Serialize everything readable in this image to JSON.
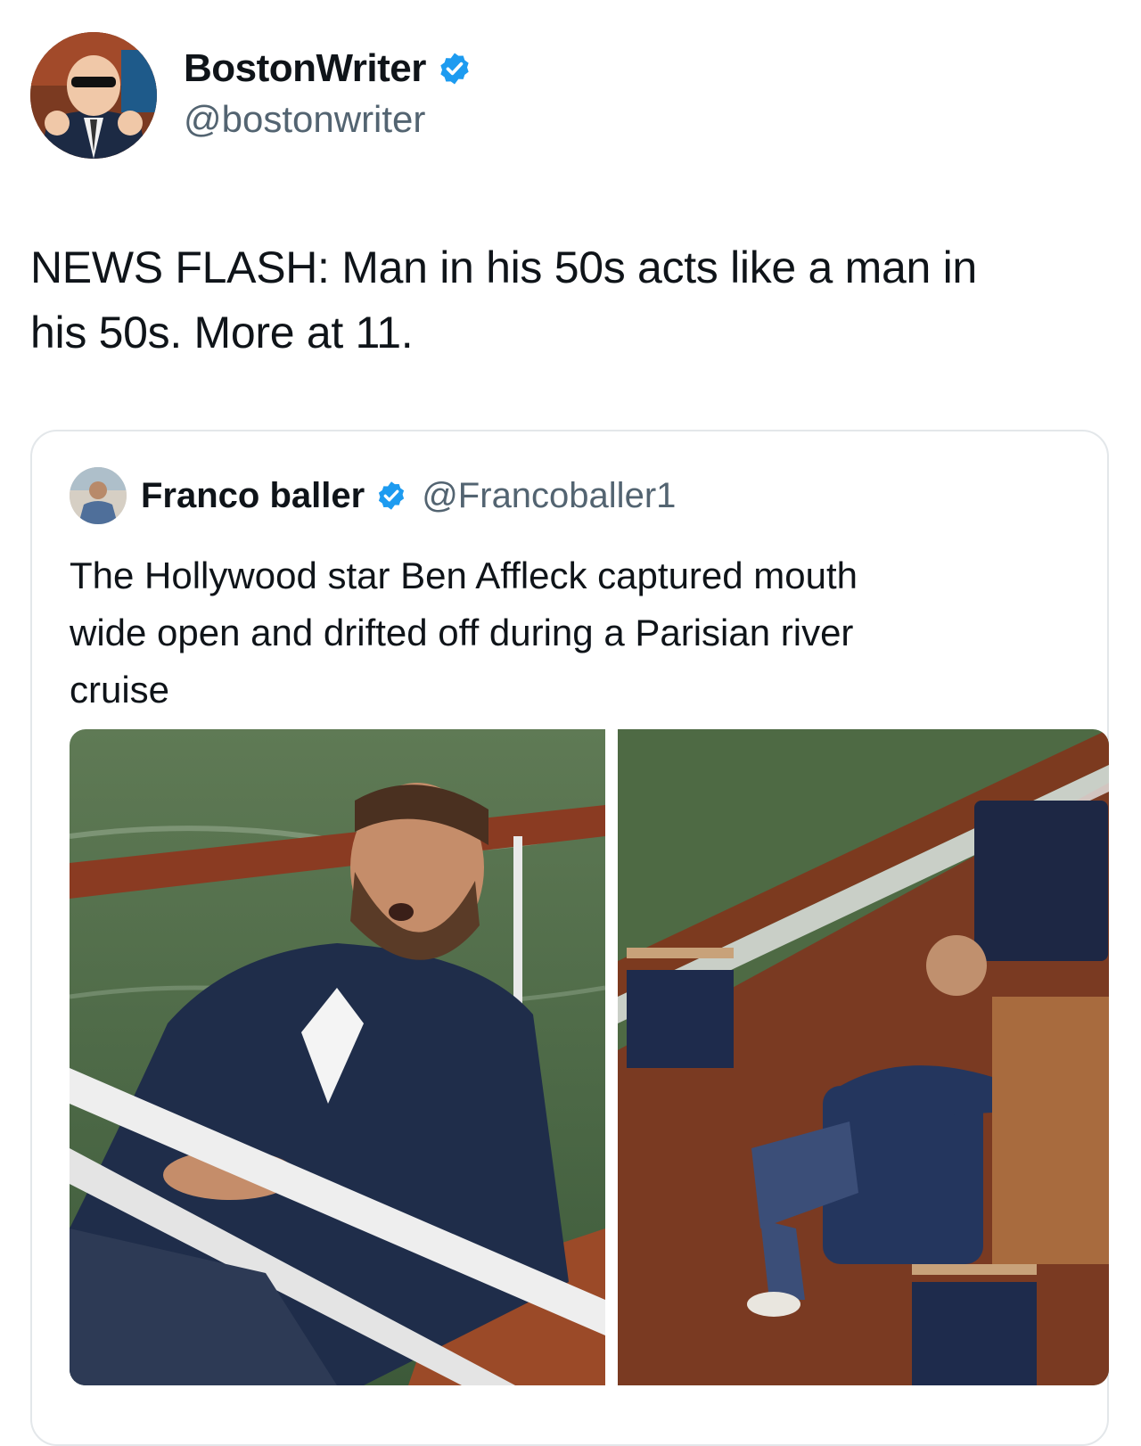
{
  "tweet": {
    "display_name": "BostonWriter",
    "handle": "@bostonwriter",
    "verified": true,
    "text_line1": "NEWS FLASH: Man in his 50s acts like a man in",
    "text_line2": "his 50s. More at 11."
  },
  "quoted_tweet": {
    "display_name": "Franco baller",
    "handle": "@Francoballer1",
    "verified": true,
    "text_line1": "The Hollywood star Ben Affleck captured mouth",
    "text_line2": "wide open and drifted off during a Parisian river",
    "text_line3": "cruise"
  },
  "colors": {
    "verified_blue": "#1d9bf0",
    "handle_gray": "#536471",
    "border": "#e3e7ea"
  }
}
